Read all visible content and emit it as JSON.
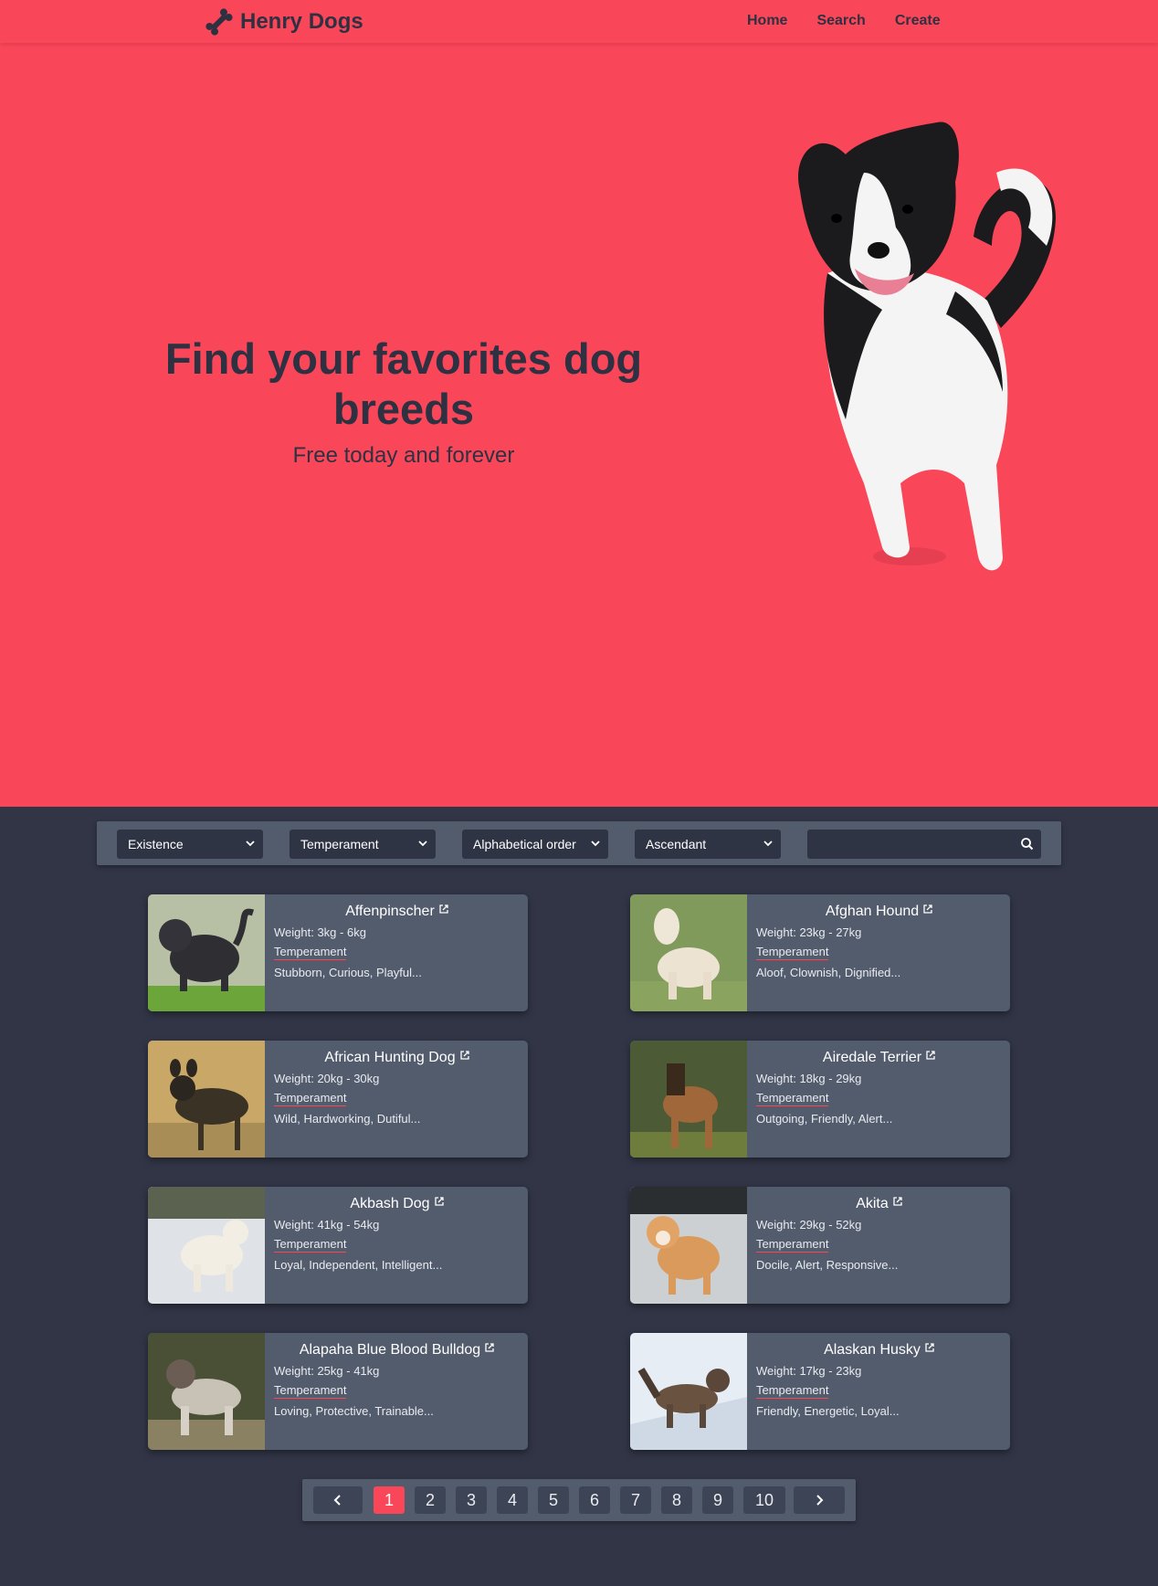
{
  "brand": {
    "name": "Henry Dogs",
    "logo_icon": "bone-icon"
  },
  "nav": {
    "home": "Home",
    "search": "Search",
    "create": "Create"
  },
  "hero": {
    "title": "Find your favorites dog breeds",
    "subtitle": "Free today and forever"
  },
  "filters": {
    "existence": "Existence",
    "temperament": "Temperament",
    "order": "Alphabetical order",
    "direction": "Ascendant",
    "search_value": ""
  },
  "cards": [
    {
      "name": "Affenpinscher",
      "weight": "Weight: 3kg - 6kg",
      "temperament_label": "Temperament",
      "temperament": "Stubborn, Curious, Playful..."
    },
    {
      "name": "Afghan Hound",
      "weight": "Weight: 23kg - 27kg",
      "temperament_label": "Temperament",
      "temperament": "Aloof, Clownish, Dignified..."
    },
    {
      "name": "African Hunting Dog",
      "weight": "Weight: 20kg - 30kg",
      "temperament_label": "Temperament",
      "temperament": "Wild, Hardworking, Dutiful..."
    },
    {
      "name": "Airedale Terrier",
      "weight": "Weight: 18kg - 29kg",
      "temperament_label": "Temperament",
      "temperament": "Outgoing, Friendly, Alert..."
    },
    {
      "name": "Akbash Dog",
      "weight": "Weight: 41kg - 54kg",
      "temperament_label": "Temperament",
      "temperament": "Loyal, Independent, Intelligent..."
    },
    {
      "name": "Akita",
      "weight": "Weight: 29kg - 52kg",
      "temperament_label": "Temperament",
      "temperament": "Docile, Alert, Responsive..."
    },
    {
      "name": "Alapaha Blue Blood Bulldog",
      "weight": "Weight: 25kg - 41kg",
      "temperament_label": "Temperament",
      "temperament": "Loving, Protective, Trainable..."
    },
    {
      "name": "Alaskan Husky",
      "weight": "Weight: 17kg - 23kg",
      "temperament_label": "Temperament",
      "temperament": "Friendly, Energetic, Loyal..."
    }
  ],
  "pagination": {
    "pages": [
      "1",
      "2",
      "3",
      "4",
      "5",
      "6",
      "7",
      "8",
      "9",
      "10"
    ],
    "current": "1"
  },
  "colors": {
    "accent": "#fa4659",
    "background": "#313546",
    "panel": "#535c6d",
    "text_dark": "#2e3141"
  }
}
